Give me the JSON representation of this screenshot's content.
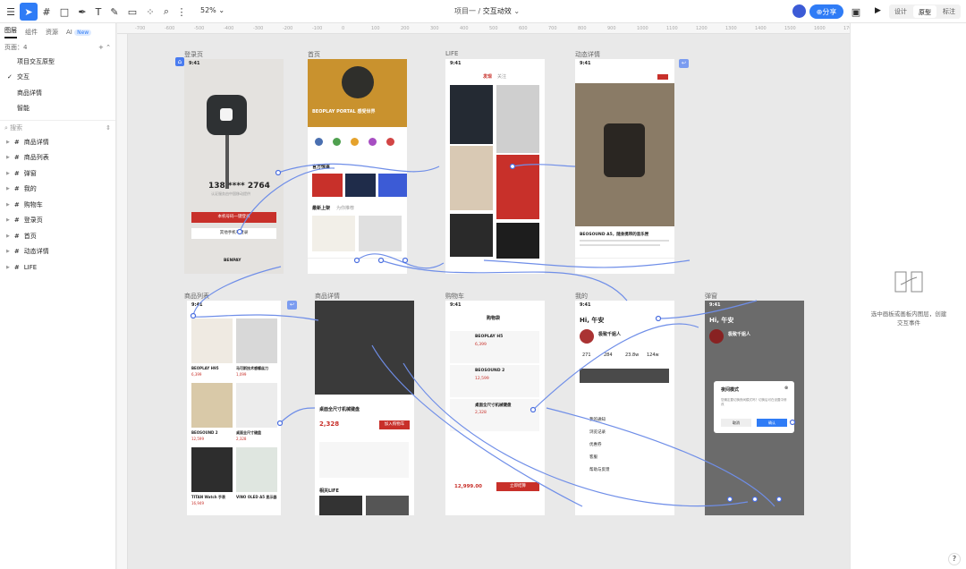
{
  "toolbar": {
    "zoom": "52%",
    "project": "项目一 /",
    "file": "交互动效",
    "share": "分享",
    "modes": [
      "设计",
      "原型",
      "标注"
    ],
    "icons": [
      "menu-icon",
      "select-icon",
      "frame-icon",
      "rectangle-icon",
      "pen-icon",
      "text-icon",
      "pencil-icon",
      "comment-icon",
      "component-icon",
      "search-icon",
      "more-icon"
    ]
  },
  "sidebar": {
    "tabs": [
      "图层",
      "组件",
      "资源",
      "AI"
    ],
    "new_badge": "New",
    "pages_label": "页面：4",
    "pages": [
      "项目交互原型",
      "交互",
      "商品详情",
      "智能"
    ],
    "active_page": "交互",
    "search_placeholder": "搜索",
    "layers": [
      "商品详情",
      "商品列表",
      "弹窗",
      "我的",
      "购物车",
      "登录页",
      "首页",
      "动态详情",
      "LIFE"
    ]
  },
  "ruler": [
    "-700",
    "-600",
    "-500",
    "-400",
    "-300",
    "-200",
    "-100",
    "0",
    "100",
    "200",
    "300",
    "400",
    "500",
    "600",
    "700",
    "800",
    "900",
    "1000",
    "1100",
    "1200",
    "1300",
    "1400",
    "1500",
    "1600",
    "1700",
    "1800"
  ],
  "frames": {
    "login": {
      "label": "登录页",
      "phone": "138 **** 2764",
      "sub": "认证服务由中国移动提供",
      "btn1": "本机号码一键登录",
      "btn2": "其他手机号登录",
      "brand": "BENPAY"
    },
    "home": {
      "label": "首页",
      "banner": "BEOPLAY PORTAL 感受世界",
      "sec1": "官方惊喜",
      "sec2": "最新上架",
      "sec3": "为你推荐"
    },
    "life": {
      "label": "LIFE",
      "tab1": "发现",
      "tab2": "关注"
    },
    "detail": {
      "label": "动态详情",
      "title": "BEOSOUND A5，随身携带的音乐匣"
    },
    "list": {
      "label": "商品列表",
      "items": [
        {
          "name": "BEOPLAY H95",
          "price": "6,399"
        },
        {
          "name": "马可斯技术感螺丝刀",
          "price": "1,099"
        },
        {
          "name": "BEOSOUND 2",
          "price": "12,599"
        },
        {
          "name": "桌面全尺寸键盘",
          "price": "2,328"
        },
        {
          "name": "TITAN Watch 手表",
          "price": "16,949"
        },
        {
          "name": "VINO OLED A5 显示器",
          "price": ""
        }
      ]
    },
    "pdetail": {
      "label": "商品详情",
      "title": "桌面全尺寸机械键盘",
      "price": "2,328",
      "btn": "加入购物车",
      "more": "相关LIFE"
    },
    "cart": {
      "label": "购物车",
      "title": "购物袋",
      "item1": "BEOPLAY H5",
      "item2": "BEOSOUND 2",
      "item3": "桌面全尺寸机械键盘",
      "p1": "6,399",
      "p2": "12,599",
      "p3": "2,328",
      "total": "12,999.00",
      "checkout": "立即结算"
    },
    "mine": {
      "label": "我的",
      "greet": "Hi, 午安",
      "name": "极致千姐人",
      "stats": [
        "271",
        "284",
        "23.8w",
        "124w"
      ],
      "menu": [
        "我的通知",
        "浏览记录",
        "优惠券",
        "客服",
        "帮助与反馈"
      ]
    },
    "popup": {
      "label": "弹窗",
      "greet": "Hi, 午安",
      "name": "极致千姐人",
      "dlg_title": "夜间模式",
      "dlg_body": "您确定要切换夜间模式吗？切换后可在设置中修改",
      "cancel": "取消",
      "ok": "确认"
    }
  },
  "right_panel": {
    "hint": "选中画板或画板内图层，创建交互事件"
  },
  "colors": {
    "accent": "#2f7cf6",
    "brand_red": "#c8302a",
    "wire": "#6f8ee8"
  }
}
